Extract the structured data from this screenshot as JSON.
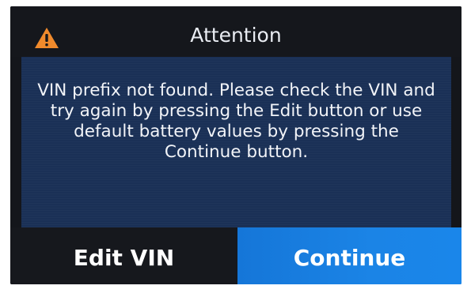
{
  "dialog": {
    "title": "Attention",
    "icon": "warning-icon",
    "message": "VIN prefix not found. Please check the VIN and try again by pressing the Edit button or use default battery values by pressing the Continue button."
  },
  "buttons": {
    "edit_label": "Edit VIN",
    "continue_label": "Continue"
  },
  "colors": {
    "warning": "#f08a2c",
    "panel": "#1a3056",
    "primary_button": "#1a7fe0",
    "background": "#14161b"
  }
}
